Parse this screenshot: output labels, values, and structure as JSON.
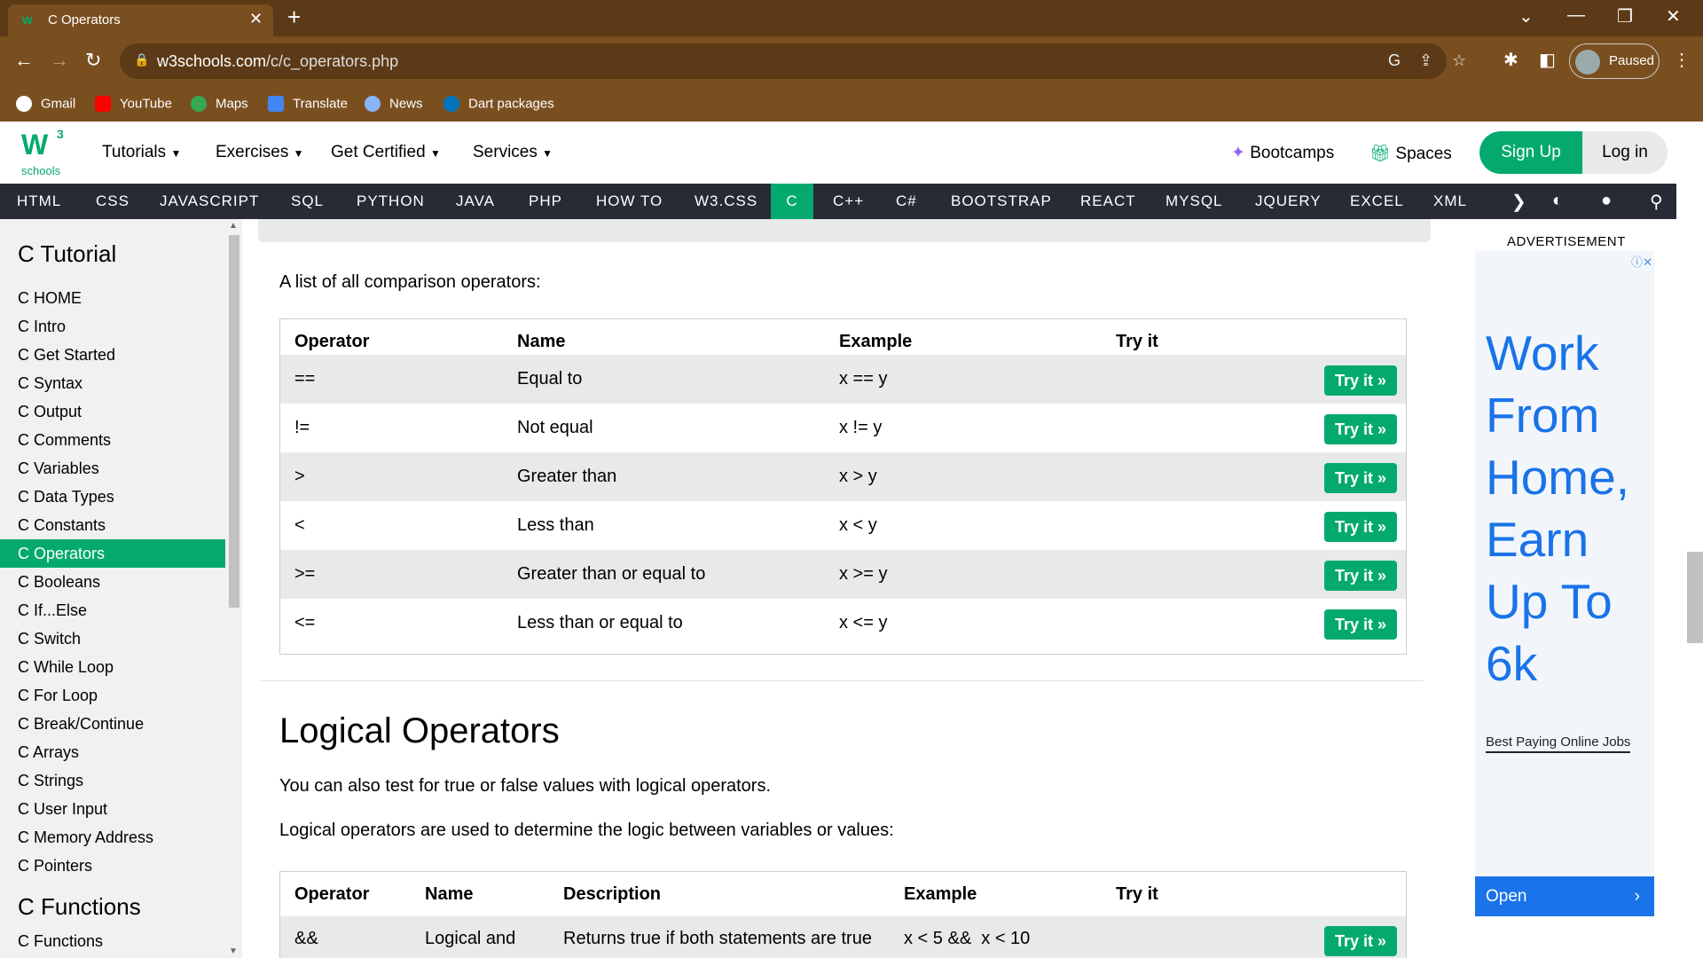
{
  "browser": {
    "tab_title": "C Operators",
    "url_domain": "w3schools.com",
    "url_path": "/c/c_operators.php",
    "profile_label": "Paused",
    "bookmarks": [
      "Gmail",
      "YouTube",
      "Maps",
      "Translate",
      "News",
      "Dart packages"
    ]
  },
  "header": {
    "logo_letters": "W",
    "logo_superscript": "3",
    "logo_sub": "schools",
    "menus": [
      "Tutorials",
      "Exercises",
      "Get Certified",
      "Services"
    ],
    "bootcamps": "Bootcamps",
    "spaces": "Spaces",
    "signup": "Sign Up",
    "login": "Log in"
  },
  "topnav": {
    "items": [
      "HTML",
      "CSS",
      "JAVASCRIPT",
      "SQL",
      "PYTHON",
      "JAVA",
      "PHP",
      "HOW TO",
      "W3.CSS",
      "C",
      "C++",
      "C#",
      "BOOTSTRAP",
      "REACT",
      "MYSQL",
      "JQUERY",
      "EXCEL",
      "XML"
    ],
    "active": "C"
  },
  "sidebar": {
    "heading1": "C Tutorial",
    "items": [
      "C HOME",
      "C Intro",
      "C Get Started",
      "C Syntax",
      "C Output",
      "C Comments",
      "C Variables",
      "C Data Types",
      "C Constants",
      "C Operators",
      "C Booleans",
      "C If...Else",
      "C Switch",
      "C While Loop",
      "C For Loop",
      "C Break/Continue",
      "C Arrays",
      "C Strings",
      "C User Input",
      "C Memory Address",
      "C Pointers"
    ],
    "active": "C Operators",
    "heading2": "C Functions",
    "items2": [
      "C Functions"
    ]
  },
  "main": {
    "intro": "A list of all comparison operators:",
    "comparison_table": {
      "headers": [
        "Operator",
        "Name",
        "Example",
        "Try it"
      ],
      "rows": [
        [
          "==",
          "Equal to",
          "x == y"
        ],
        [
          "!=",
          "Not equal",
          "x != y"
        ],
        [
          ">",
          "Greater than",
          "x > y"
        ],
        [
          "<",
          "Less than",
          "x < y"
        ],
        [
          ">=",
          "Greater than or equal to",
          "x >= y"
        ],
        [
          "<=",
          "Less than or equal to",
          "x <= y"
        ]
      ],
      "try_label": "Try it »"
    },
    "logical_heading": "Logical Operators",
    "logical_p1": "You can also test for true or false values with logical operators.",
    "logical_p2": "Logical operators are used to determine the logic between variables or values:",
    "logical_table": {
      "headers": [
        "Operator",
        "Name",
        "Description",
        "Example",
        "Try it"
      ],
      "rows": [
        [
          "&&",
          "Logical and",
          "Returns true if both statements are true",
          "x < 5 &&  x < 10"
        ]
      ],
      "try_label": "Try it »"
    }
  },
  "ad": {
    "label": "ADVERTISEMENT",
    "headline": "Work From Home, Earn Up To 6k",
    "subline": "Best Paying Online Jobs",
    "cta": "Open"
  },
  "colors": {
    "accent": "#04aa6d",
    "topnav_bg": "#282a35",
    "chrome_bg": "#7a4f20"
  }
}
